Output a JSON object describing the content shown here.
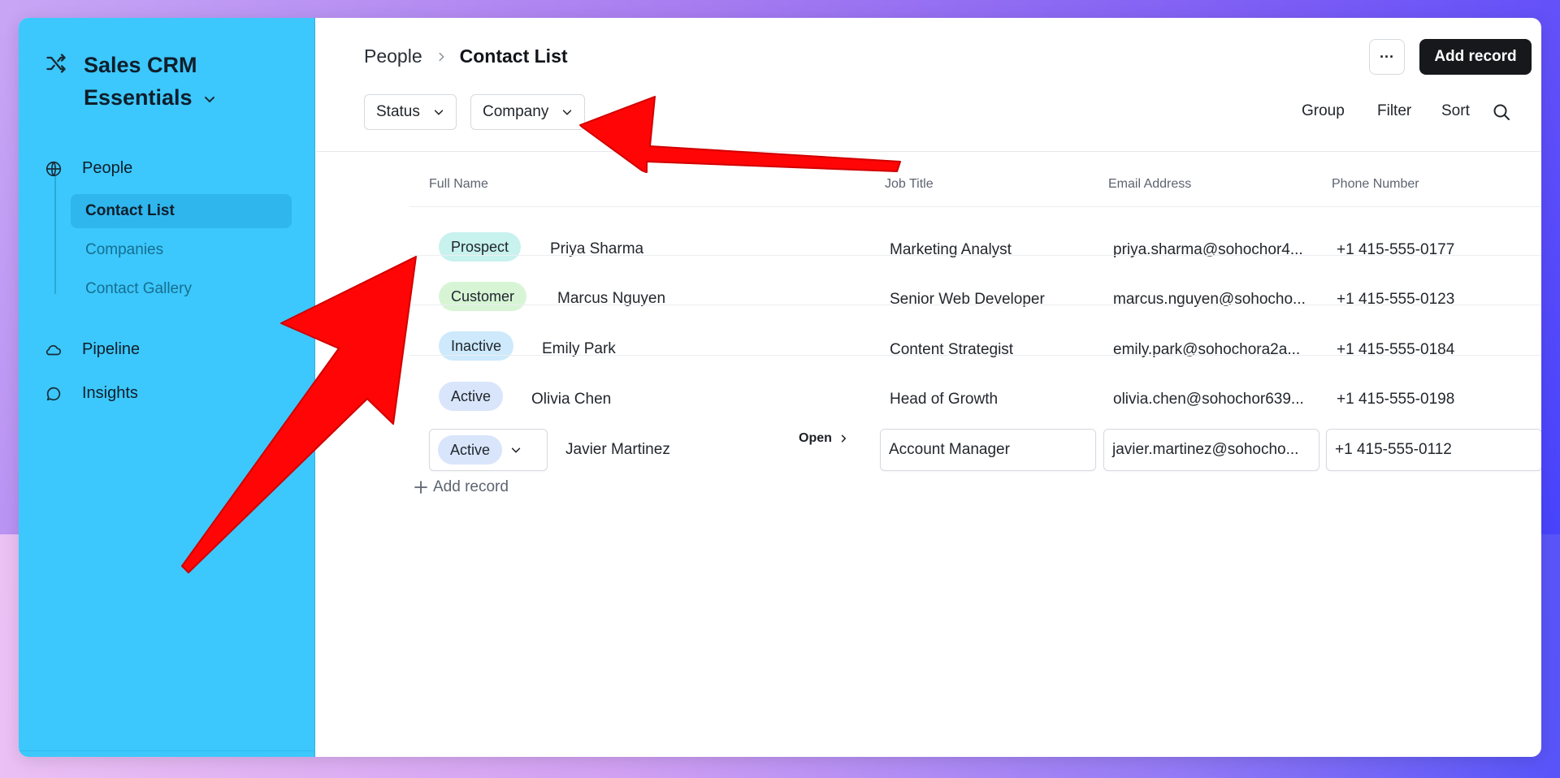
{
  "app": {
    "title": "Sales CRM Essentials"
  },
  "sidebar": {
    "sections": [
      {
        "label": "People",
        "icon": "globe-icon"
      },
      {
        "label": "Pipeline",
        "icon": "cloud-icon"
      },
      {
        "label": "Insights",
        "icon": "chat-bubble-icon"
      }
    ],
    "sub_items": [
      {
        "label": "Contact List",
        "active": true
      },
      {
        "label": "Companies",
        "active": false
      },
      {
        "label": "Contact Gallery",
        "active": false
      }
    ]
  },
  "header": {
    "breadcrumb_parent": "People",
    "breadcrumb_current": "Contact List",
    "more_label": "···",
    "add_record_label": "Add record"
  },
  "filters": {
    "status_label": "Status",
    "company_label": "Company"
  },
  "toolbar": {
    "group_label": "Group",
    "filter_label": "Filter",
    "sort_label": "Sort"
  },
  "table": {
    "columns": [
      "Full Name",
      "Job Title",
      "Email Address",
      "Phone Number"
    ],
    "rows": [
      {
        "status": "Prospect",
        "name": "Priya Sharma",
        "job": "Marketing Analyst",
        "email": "priya.sharma@sohochor4...",
        "phone": "+1 415-555-0177"
      },
      {
        "status": "Customer",
        "name": "Marcus Nguyen",
        "job": "Senior Web Developer",
        "email": "marcus.nguyen@sohocho...",
        "phone": "+1 415-555-0123"
      },
      {
        "status": "Inactive",
        "name": "Emily Park",
        "job": "Content Strategist",
        "email": "emily.park@sohochora2a...",
        "phone": "+1 415-555-0184"
      },
      {
        "status": "Active",
        "name": "Olivia Chen",
        "job": "Head of Growth",
        "email": "olivia.chen@sohochor639...",
        "phone": "+1 415-555-0198"
      },
      {
        "status": "Active",
        "name": "Javier Martinez",
        "job": "Account Manager",
        "email": "javier.martinez@sohocho...",
        "phone": "+1 415-555-0112"
      }
    ],
    "open_label": "Open",
    "add_record_label": "Add record"
  },
  "colors": {
    "sidebar_bg": "#3cc8fc",
    "primary_button": "#16181c",
    "annotation_arrow": "#ff0000"
  }
}
